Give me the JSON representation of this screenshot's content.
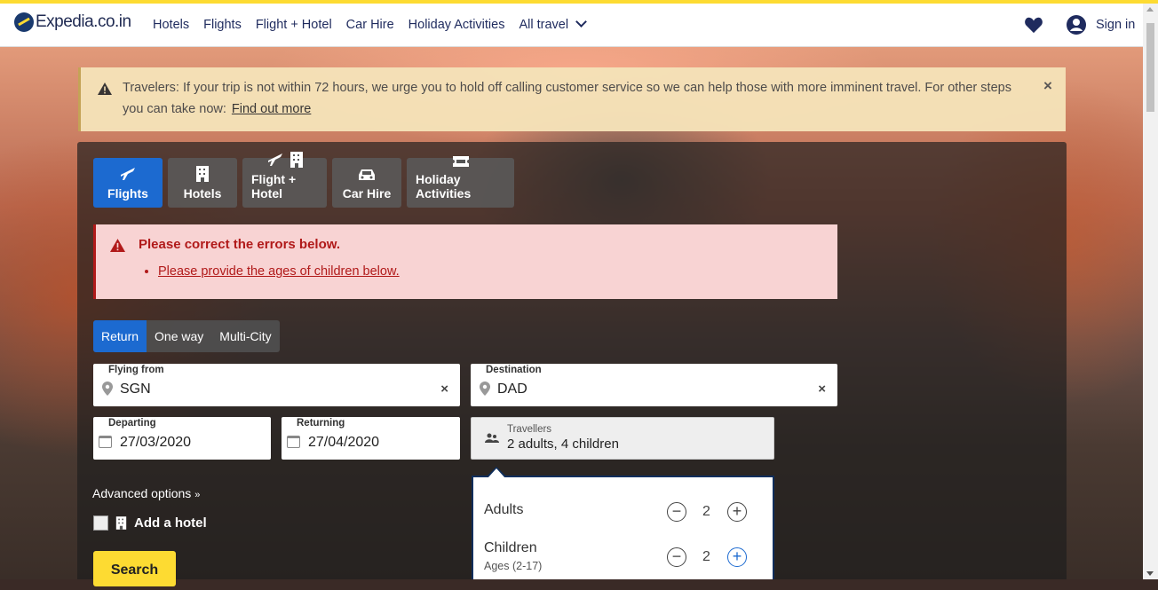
{
  "header": {
    "brand": "Expedia.co.in",
    "nav": [
      "Hotels",
      "Flights",
      "Flight + Hotel",
      "Car Hire",
      "Holiday Activities",
      "All travel"
    ],
    "sign_in": "Sign in"
  },
  "alert": {
    "message": "Travelers: If your trip is not within 72 hours, we urge you to hold off calling customer service so we can help those with more imminent travel. For other steps you can take now:",
    "link": "Find out more",
    "close": "×"
  },
  "tabs": [
    {
      "label": "Flights",
      "icon": "plane-icon",
      "active": true
    },
    {
      "label": "Hotels",
      "icon": "building-icon",
      "active": false
    },
    {
      "label": "Flight + Hotel",
      "icon": "plane-building-icon",
      "active": false
    },
    {
      "label": "Car Hire",
      "icon": "car-icon",
      "active": false
    },
    {
      "label": "Holiday Activities",
      "icon": "ticket-icon",
      "active": false
    }
  ],
  "error": {
    "title": "Please correct the errors below.",
    "items": [
      "Please provide the ages of children below."
    ]
  },
  "trip_type": {
    "options": [
      "Return",
      "One way",
      "Multi-City"
    ],
    "selected": "Return"
  },
  "form": {
    "from": {
      "label": "Flying from",
      "value": "SGN"
    },
    "to": {
      "label": "Destination",
      "value": "DAD"
    },
    "departing": {
      "label": "Departing",
      "value": "27/03/2020"
    },
    "returning": {
      "label": "Returning",
      "value": "27/04/2020"
    },
    "travellers": {
      "label": "Travellers",
      "value": "2 adults, 4 children"
    },
    "clear": "×"
  },
  "advanced": "Advanced options",
  "add_hotel": "Add a hotel",
  "search": "Search",
  "traveller_popup": {
    "adults": {
      "label": "Adults",
      "count": "2"
    },
    "children": {
      "label": "Children",
      "sub": "Ages (2-17)",
      "count": "2"
    },
    "minus": "−",
    "plus": "+"
  },
  "colors": {
    "accent": "#1c6ad0",
    "brand_yellow": "#fddb32",
    "error": "#b11a1a"
  }
}
